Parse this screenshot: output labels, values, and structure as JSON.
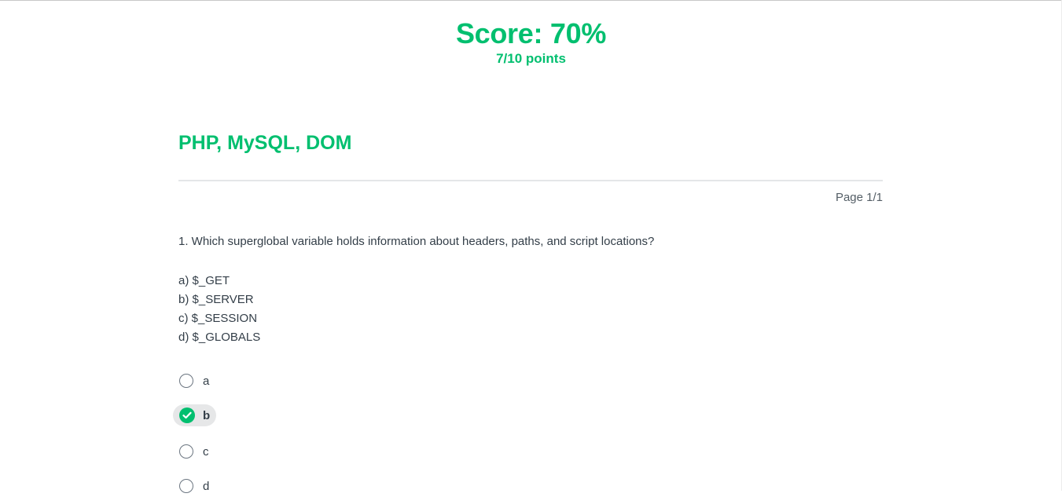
{
  "score": {
    "title": "Score: 70%",
    "points": "7/10 points"
  },
  "survey": {
    "title": "PHP, MySQL, DOM",
    "page_indicator": "Page 1/1"
  },
  "question": {
    "text": "1. Which superglobal variable holds information about headers, paths, and script locations?",
    "options": [
      "a) $_GET",
      "b) $_SERVER",
      "c) $_SESSION",
      "d) $_GLOBALS"
    ],
    "answers": [
      {
        "label": "a",
        "selected": false
      },
      {
        "label": "b",
        "selected": true
      },
      {
        "label": "c",
        "selected": false
      },
      {
        "label": "d",
        "selected": false
      }
    ]
  },
  "colors": {
    "accent": "#00bf6f",
    "text": "#333e48",
    "selected_bg": "#e6e7e8"
  },
  "icons": {
    "selected": "check-circle-icon",
    "unselected": "radio-empty-icon"
  }
}
